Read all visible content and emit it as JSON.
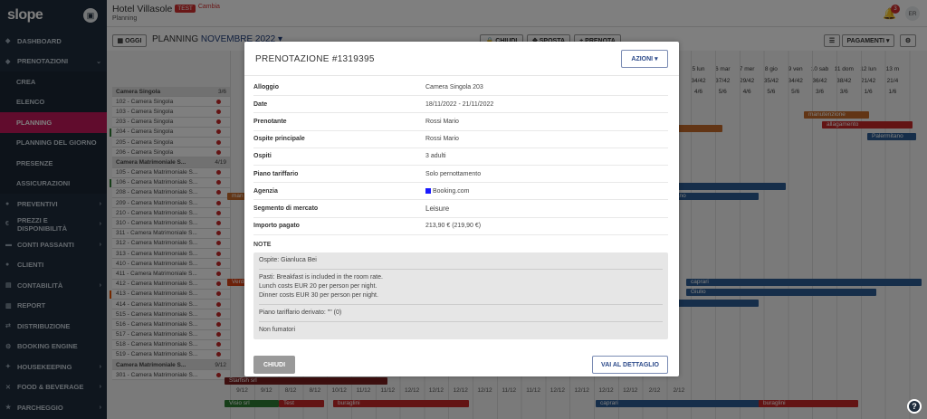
{
  "sidebar": {
    "logo": "slope",
    "items": [
      {
        "icon": "◆",
        "label": "DASHBOARD"
      },
      {
        "icon": "◆",
        "label": "PRENOTAZIONI",
        "chev": "⌄"
      }
    ],
    "subitems": [
      "CREA",
      "ELENCO",
      "PLANNING",
      "PLANNING DEL GIORNO",
      "PRESENZE",
      "ASSICURAZIONI"
    ],
    "active_sub": "PLANNING",
    "items2": [
      {
        "icon": "●",
        "label": "PREVENTIVI",
        "chev": "›"
      },
      {
        "icon": "€",
        "label": "PREZZI E DISPONIBILITÀ",
        "chev": "›"
      },
      {
        "icon": "▬",
        "label": "CONTI PASSANTI",
        "chev": "›"
      },
      {
        "icon": "●",
        "label": "CLIENTI",
        "chev": ""
      },
      {
        "icon": "▤",
        "label": "CONTABILITÀ",
        "chev": "›"
      },
      {
        "icon": "▥",
        "label": "REPORT",
        "chev": ""
      },
      {
        "icon": "⇄",
        "label": "DISTRIBUZIONE",
        "chev": ""
      },
      {
        "icon": "⚙",
        "label": "BOOKING ENGINE",
        "chev": ""
      },
      {
        "icon": "✦",
        "label": "HOUSEKEEPING",
        "chev": "›"
      },
      {
        "icon": "✕",
        "label": "FOOD & BEVERAGE",
        "chev": "›"
      },
      {
        "icon": "★",
        "label": "PARCHEGGIO",
        "chev": "›"
      }
    ]
  },
  "header": {
    "hotel": "Hotel Villasole",
    "badge": "TEST",
    "cambia": "Cambia",
    "subtitle": "Planning",
    "notifications": "3",
    "avatar": "ER"
  },
  "toolbar": {
    "oggi": "OGGI",
    "planning": "PLANNING",
    "month": "NOVEMBRE 2022",
    "chiudi": "CHIUDI",
    "sposta": "SPOSTA",
    "prenota": "PRENOTA",
    "pagamenti": "PAGAMENTI"
  },
  "grid": {
    "day_headers": [
      "5 lun",
      "6 mar",
      "7 mer",
      "8 gio",
      "9 ven",
      "10 sab",
      "11 dom",
      "12 lun",
      "13 m"
    ],
    "day_counts": [
      "34/42",
      "37/42",
      "29/42",
      "35/42",
      "34/42",
      "36/42",
      "38/42",
      "21/42",
      "21/4"
    ],
    "ratio_row": [
      "4/6",
      "5/6",
      "4/6",
      "5/6",
      "5/6",
      "3/6",
      "3/6",
      "1/6",
      "1/6"
    ],
    "rooms": [
      {
        "name": "Camera Singola",
        "cat": true,
        "count": "3/6"
      },
      {
        "name": "102 - Camera Singola"
      },
      {
        "name": "103 - Camera Singola"
      },
      {
        "name": "203 - Camera Singola"
      },
      {
        "name": "204 - Camera Singola"
      },
      {
        "name": "205 - Camera Singola"
      },
      {
        "name": "206 - Camera Singola"
      },
      {
        "name": "Camera Matrimoniale S...",
        "cat": true,
        "count": "4/19"
      },
      {
        "name": "105 - Camera Matrimoniale S..."
      },
      {
        "name": "106 - Camera Matrimoniale S..."
      },
      {
        "name": "208 - Camera Matrimoniale S..."
      },
      {
        "name": "209 - Camera Matrimoniale S..."
      },
      {
        "name": "210 - Camera Matrimoniale S..."
      },
      {
        "name": "310 - Camera Matrimoniale S..."
      },
      {
        "name": "311 - Camera Matrimoniale S..."
      },
      {
        "name": "312 - Camera Matrimoniale S..."
      },
      {
        "name": "313 - Camera Matrimoniale S..."
      },
      {
        "name": "410 - Camera Matrimoniale S..."
      },
      {
        "name": "411 - Camera Matrimoniale S..."
      },
      {
        "name": "412 - Camera Matrimoniale S..."
      },
      {
        "name": "413 - Camera Matrimoniale S..."
      },
      {
        "name": "414 - Camera Matrimoniale S..."
      },
      {
        "name": "515 - Camera Matrimoniale S..."
      },
      {
        "name": "516 - Camera Matrimoniale S..."
      },
      {
        "name": "517 - Camera Matrimoniale S..."
      },
      {
        "name": "518 - Camera Matrimoniale S..."
      },
      {
        "name": "519 - Camera Matrimoniale S..."
      },
      {
        "name": "Camera Matrimoniale S...",
        "cat": true,
        "count": "9/12"
      },
      {
        "name": "301 - Camera Matrimoniale S..."
      }
    ],
    "bar_labels": [
      "manutenzione",
      "allagamento",
      "Palermitano",
      "Prova",
      "Rossi",
      "Palermitano",
      "caprari",
      "Giulio",
      "Viola",
      "Starfish srl",
      "Visio srl",
      "Test",
      "buraglini",
      "caprari",
      "buraglini",
      "zione",
      "man",
      "Verdi"
    ],
    "bottom_ticks": [
      "9/12",
      "9/12",
      "8/12",
      "8/12",
      "10/12",
      "11/12",
      "11/12",
      "12/12",
      "12/12",
      "12/12",
      "12/12",
      "11/12",
      "11/12",
      "12/12",
      "12/12",
      "12/12",
      "12/12",
      "2/12",
      "2/12"
    ]
  },
  "modal": {
    "title": "PRENOTAZIONE #1319395",
    "azioni": "AZIONI",
    "rows": [
      {
        "label": "Alloggio",
        "value": "Camera Singola 203"
      },
      {
        "label": "Date",
        "value": "18/11/2022 - 21/11/2022"
      },
      {
        "label": "Prenotante",
        "value": "Rossi Mario"
      },
      {
        "label": "Ospite principale",
        "value": "Rossi Mario"
      },
      {
        "label": "Ospiti",
        "value": "3 adulti"
      },
      {
        "label": "Piano tariffario",
        "value": "Solo pernottamento"
      },
      {
        "label": "Agenzia",
        "value": "Booking.com"
      },
      {
        "label": "Segmento di mercato",
        "value": "Leisure"
      },
      {
        "label": "Importo pagato",
        "value": "213,90 € (219,90 €)"
      }
    ],
    "note_label": "NOTE",
    "notes": {
      "ospite": "Ospite: Gianluca Bei",
      "pasti": [
        "Pasti: Breakfast is included in the room rate.",
        "Lunch costs EUR 20 per person per night.",
        "Dinner costs EUR 30 per person per night."
      ],
      "piano": "Piano tariffario derivato: \"\" (0)",
      "fumatori": "Non fumatori"
    },
    "chiudi": "CHIUDI",
    "dettaglio": "VAI AL DETTAGLIO"
  },
  "colors": {
    "sidebar_bg": "#1f2d3d",
    "active": "#c2185b",
    "accent": "#2c4a8a"
  }
}
